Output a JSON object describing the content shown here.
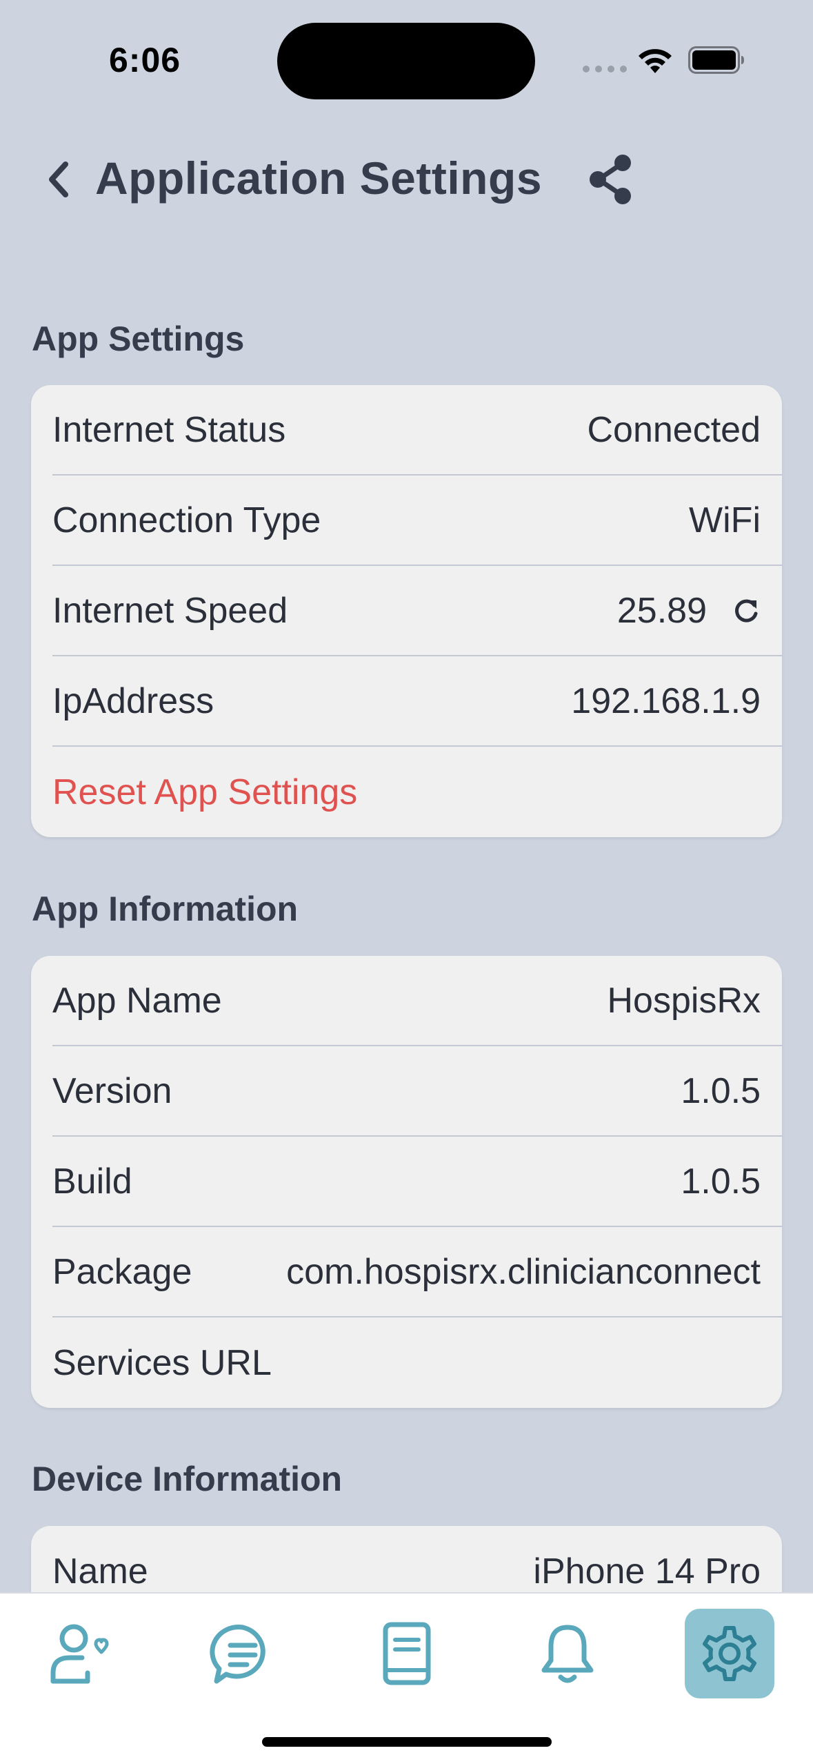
{
  "status_bar": {
    "time": "6:06"
  },
  "header": {
    "title": "Application Settings",
    "back_icon": "chevron-left-icon",
    "share_icon": "share-icon"
  },
  "app_settings": {
    "title": "App Settings",
    "rows": [
      {
        "label": "Internet Status",
        "value": "Connected"
      },
      {
        "label": "Connection Type",
        "value": "WiFi"
      },
      {
        "label": "Internet Speed",
        "value": "25.89"
      },
      {
        "label": "IpAddress",
        "value": "192.168.1.9"
      }
    ],
    "reset_label": "Reset App Settings"
  },
  "app_information": {
    "title": "App Information",
    "rows": [
      {
        "label": "App Name",
        "value": "HospisRx"
      },
      {
        "label": "Version",
        "value": "1.0.5"
      },
      {
        "label": "Build",
        "value": "1.0.5"
      },
      {
        "label": "Package",
        "value": "com.hospisrx.clinicianconnect"
      },
      {
        "label": "Services URL",
        "value": ""
      }
    ]
  },
  "device_information": {
    "title": "Device Information",
    "rows": [
      {
        "label": "Name",
        "value": "iPhone 14 Pro"
      }
    ]
  },
  "tab_bar": {
    "tabs": [
      {
        "icon": "patient-heart-icon"
      },
      {
        "icon": "chat-icon"
      },
      {
        "icon": "book-icon"
      },
      {
        "icon": "bell-icon"
      },
      {
        "icon": "gear-icon",
        "active": true
      }
    ]
  },
  "colors": {
    "background": "#cdd3df",
    "card": "#f0f0f0",
    "danger": "#e0524f",
    "accent": "#5aa8bb",
    "active_tab": "#8ec4d1"
  }
}
